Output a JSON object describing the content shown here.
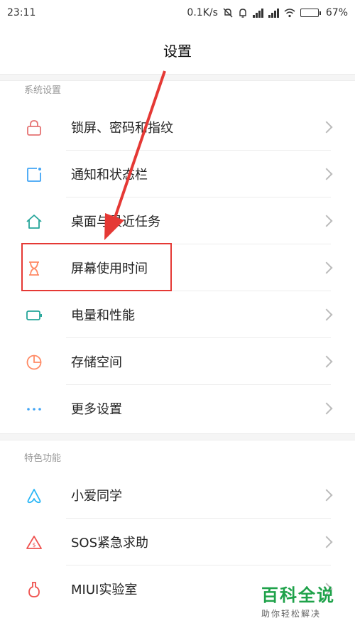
{
  "status_bar": {
    "time": "23:11",
    "net_speed": "0.1K/s",
    "battery_percent": "67%",
    "battery_level": 0.67,
    "icons": [
      "mute-icon",
      "alarm-icon",
      "signal-icon",
      "signal-icon",
      "wifi-icon",
      "battery-icon"
    ]
  },
  "header": {
    "title": "设置"
  },
  "sections": [
    {
      "title": "系统设置",
      "items": [
        {
          "label": "锁屏、密码和指纹",
          "icon": "lock-icon",
          "color": "#e57373"
        },
        {
          "label": "通知和状态栏",
          "icon": "notification-icon",
          "color": "#42a5f5"
        },
        {
          "label": "桌面与最近任务",
          "icon": "home-icon",
          "color": "#26a69a"
        },
        {
          "label": "屏幕使用时间",
          "icon": "hourglass-icon",
          "color": "#ff8a65"
        },
        {
          "label": "电量和性能",
          "icon": "battery-icon",
          "color": "#26a69a"
        },
        {
          "label": "存储空间",
          "icon": "storage-icon",
          "color": "#ff8a65"
        },
        {
          "label": "更多设置",
          "icon": "more-icon",
          "color": "#42a5f5"
        }
      ]
    },
    {
      "title": "特色功能",
      "items": [
        {
          "label": "小爱同学",
          "icon": "xiaoai-icon",
          "color": "#29b6f6"
        },
        {
          "label": "SOS紧急求助",
          "icon": "sos-icon",
          "color": "#ef5350"
        },
        {
          "label": "MIUI实验室",
          "icon": "lab-icon",
          "color": "#ef5350"
        }
      ]
    }
  ],
  "annotation": {
    "highlighted_item": "屏幕使用时间",
    "color": "#e53935"
  },
  "watermark": {
    "title": "百科全说",
    "subtitle": "助你轻松解决"
  }
}
